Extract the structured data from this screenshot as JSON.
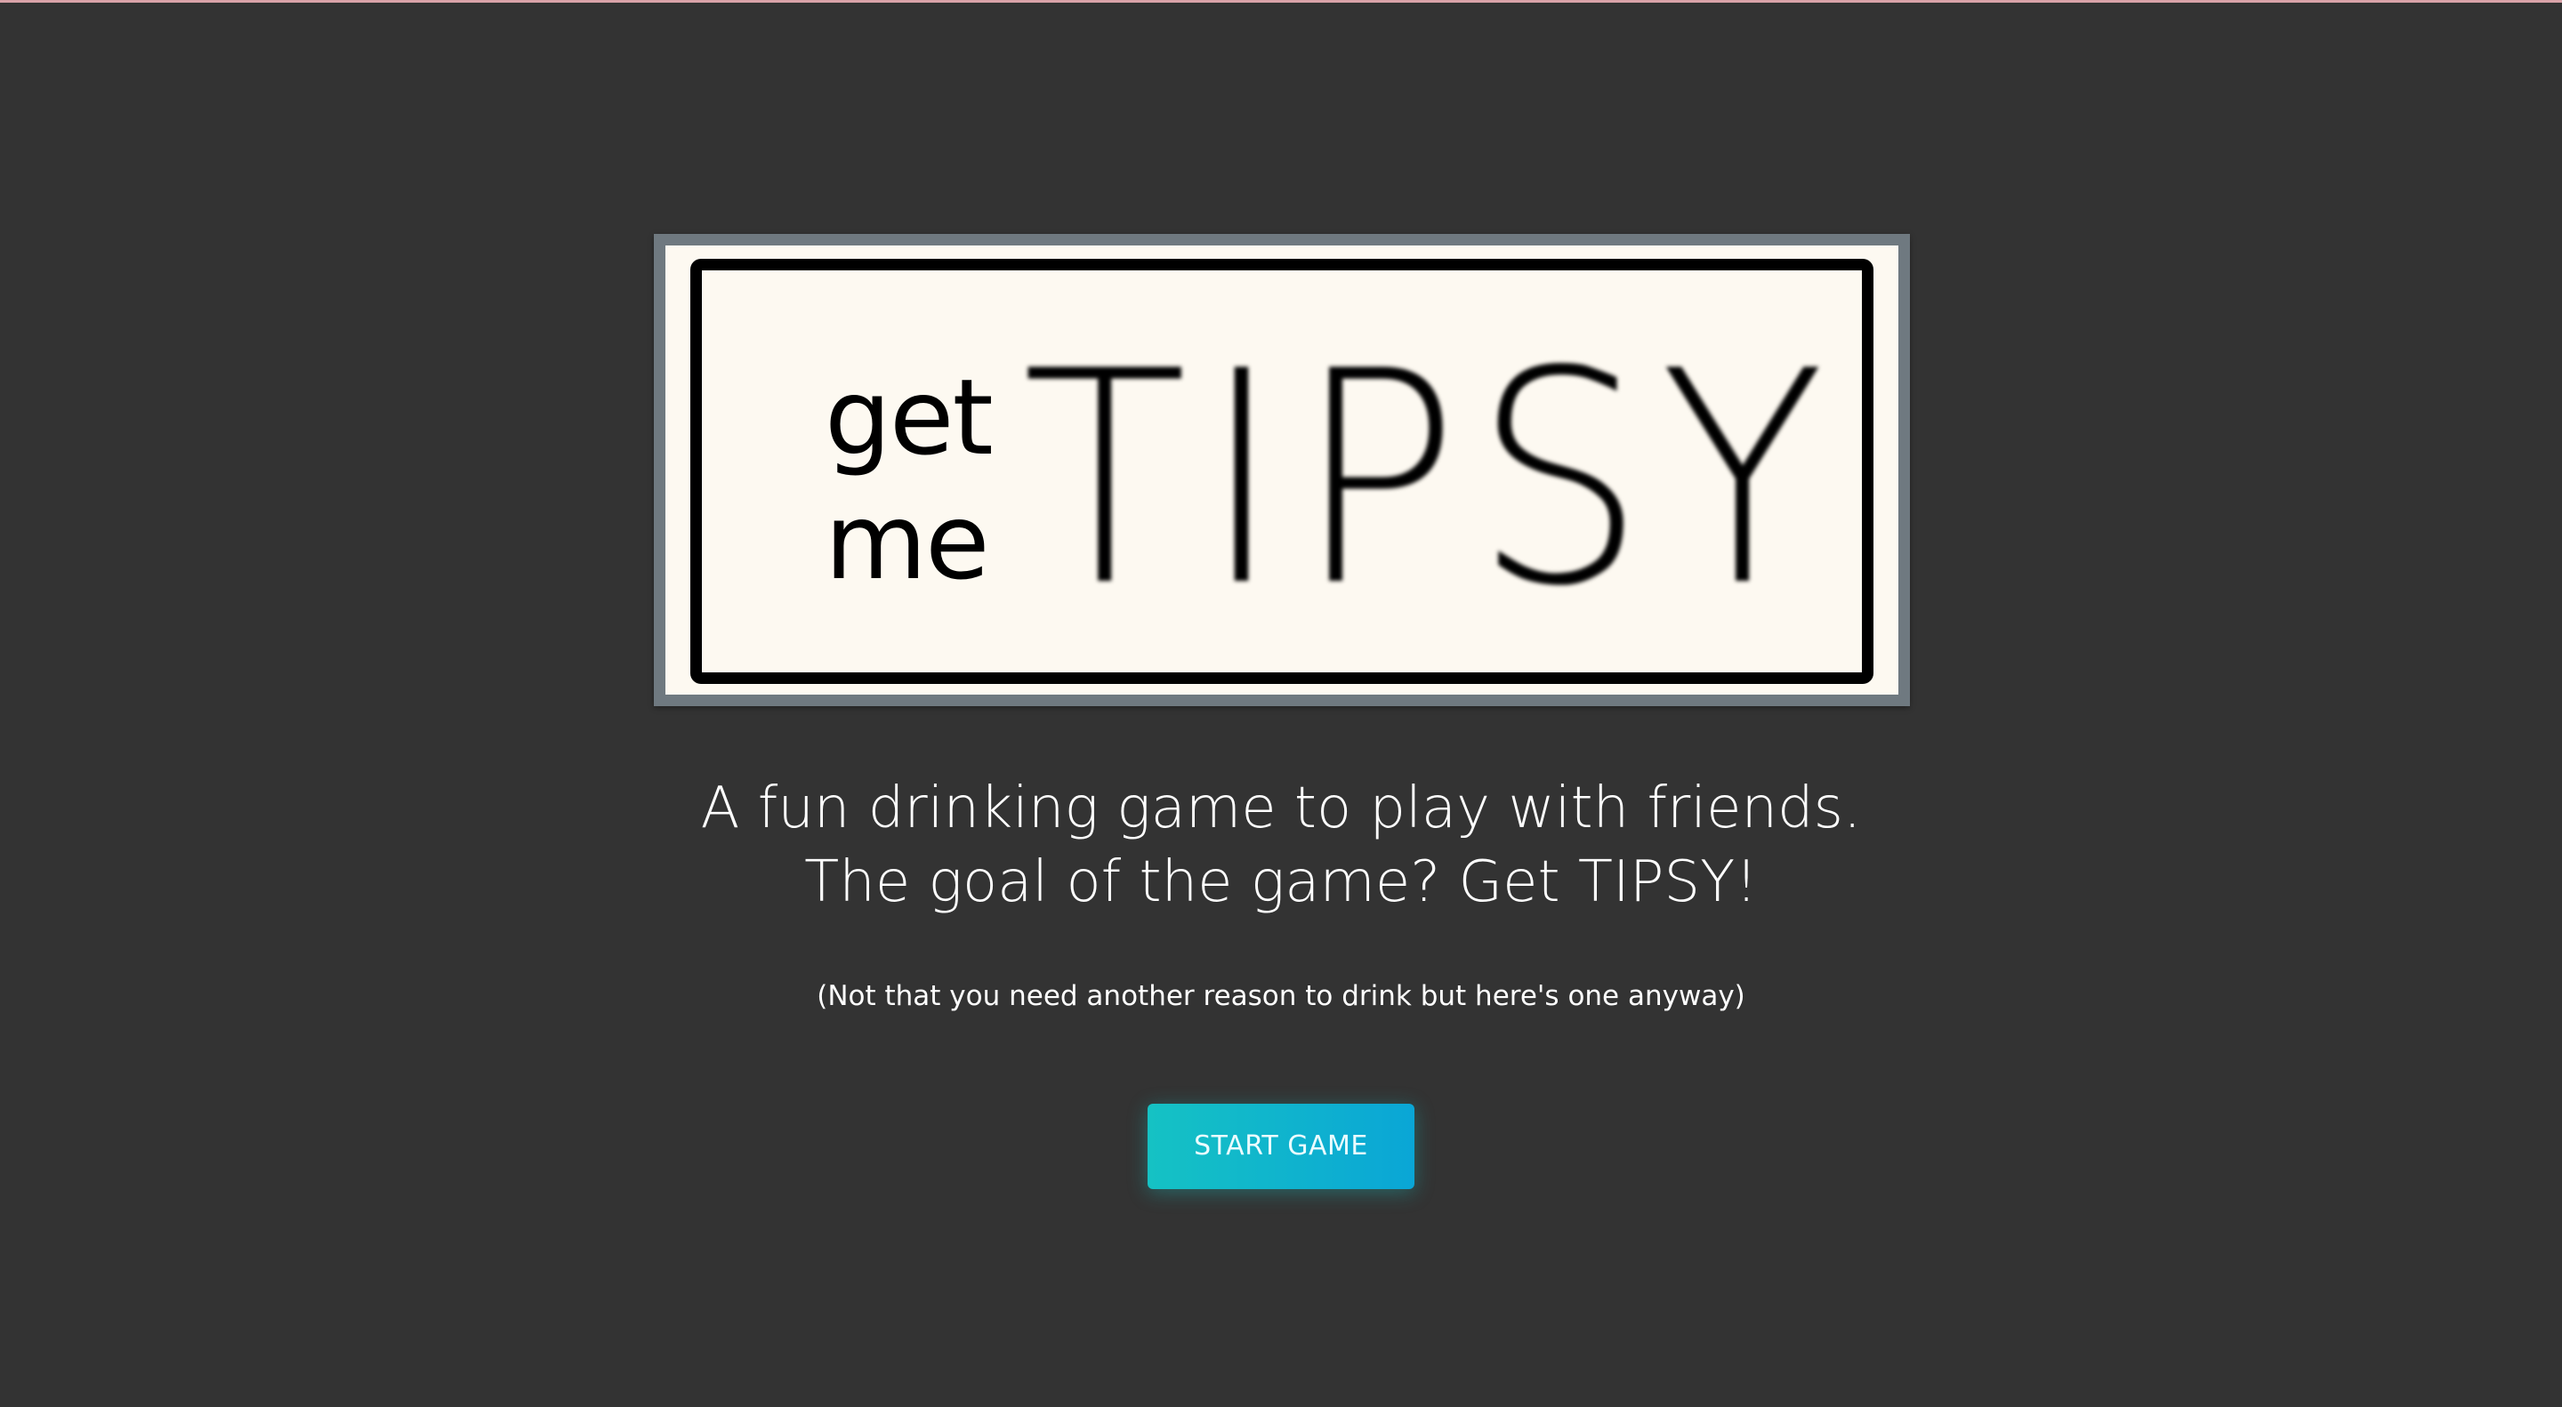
{
  "logo": {
    "line1": "get",
    "line2": "me",
    "wordmark": "TIPSY"
  },
  "tagline": {
    "line1": "A fun drinking game to play with friends.",
    "line2": "The goal of the game? Get TIPSY!"
  },
  "aside": "(Not that you need another reason to drink but here's one anyway)",
  "start_button": {
    "label": "START GAME"
  },
  "colors": {
    "background": "#333333",
    "logo_frame": "#6f7980",
    "logo_paper": "#fdf9f1",
    "button_start": "#15c2c4",
    "button_end": "#0aa6d6"
  }
}
